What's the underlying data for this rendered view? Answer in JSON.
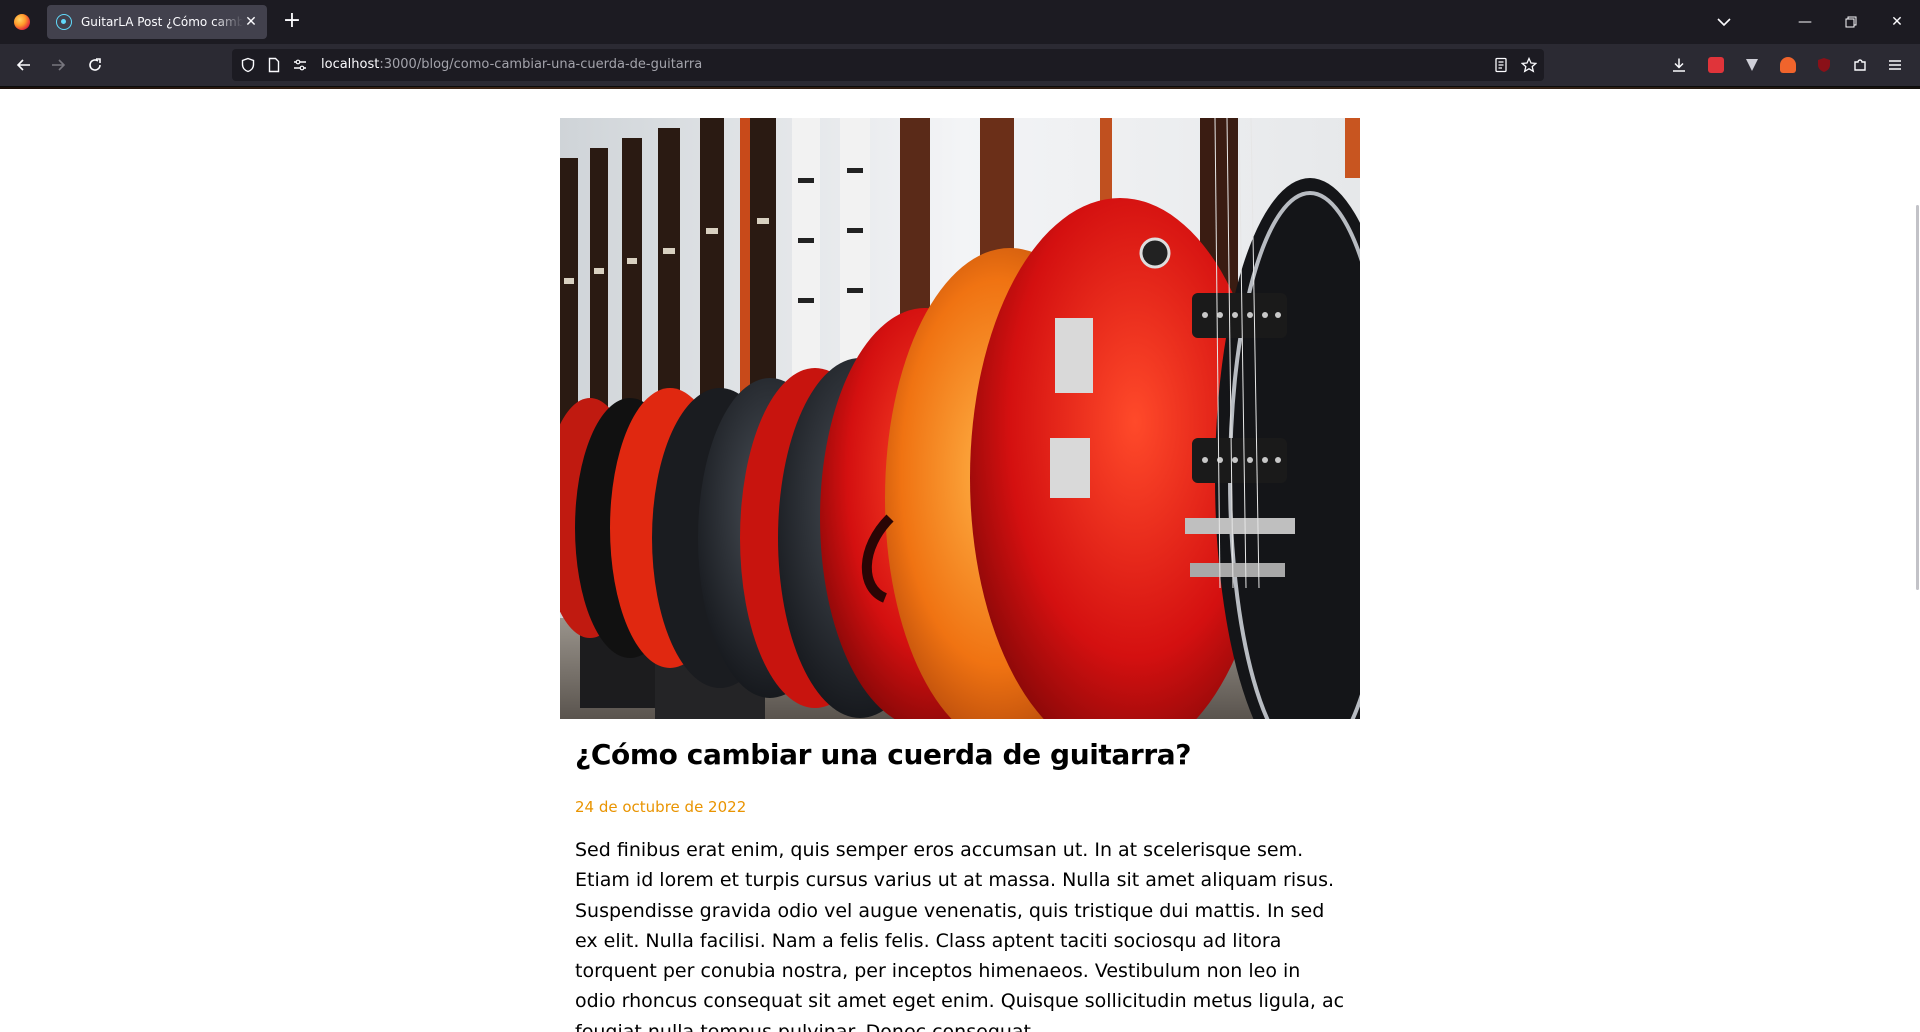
{
  "browser": {
    "tab": {
      "title": "GuitarLA Post ¿Cómo cambiar una cuerda de guitarra?",
      "close_glyph": "✕"
    },
    "new_tab_glyph": "+",
    "url": {
      "host": "localhost",
      "path": ":3000/blog/como-cambiar-una-cuerda-de-guitarra"
    },
    "window_controls": {
      "minimize": "—",
      "restore": "❐",
      "close": "✕"
    },
    "icons": [
      "firefox-icon",
      "react-favicon-icon",
      "back-icon",
      "forward-icon",
      "reload-icon",
      "shield-icon",
      "page-icon",
      "permissions-icon",
      "reader-view-icon",
      "bookmark-star-icon",
      "download-icon",
      "extension-icon",
      "menu-icon"
    ],
    "colors": {
      "tabbar": "#1c1b22",
      "toolbar": "#2b2a33",
      "urlbar": "#1c1b22",
      "tab_active": "#42414d"
    }
  },
  "post": {
    "image_alt": "Fila de guitarras eléctricas colgadas en una tienda",
    "title": "¿Cómo cambiar una cuerda de guitarra?",
    "date": "24 de octubre de 2022",
    "text": "Sed finibus erat enim, quis semper eros accumsan ut. In at scelerisque sem. Etiam id lorem et turpis cursus varius ut at massa. Nulla sit amet aliquam risus. Suspendisse gravida odio vel augue venenatis, quis tristique dui mattis. In sed ex elit. Nulla facilisi. Nam a felis felis. Class aptent taciti sociosqu ad litora torquent per conubia nostra, per inceptos himenaeos. Vestibulum non leo in odio rhoncus consequat sit amet eget enim. Quisque sollicitudin metus ligula, ac feugiat nulla tempus pulvinar. Donec consequat",
    "colors": {
      "date": "#e99401",
      "title": "#000000"
    }
  }
}
